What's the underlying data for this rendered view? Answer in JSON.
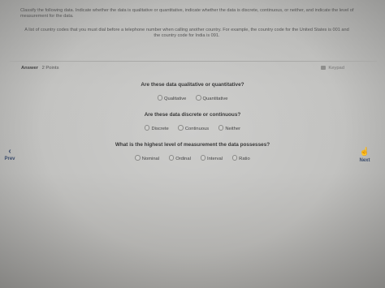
{
  "question": {
    "instructions": "Classify the following data. Indicate whether the data is qualitative or quantitative, indicate whether the data is discrete, continuous, or neither, and indicate the level of measurement for the data.",
    "example": "A list of country codes that you must dial before a telephone number when calling another country. For example, the country code for the United States is 001 and the country code for India is 091."
  },
  "answer": {
    "label": "Answer",
    "points": "2 Points",
    "keypad": "Keypad"
  },
  "parts": [
    {
      "prompt": "Are these data qualitative or quantitative?",
      "options": [
        "Qualitative",
        "Quantitative"
      ]
    },
    {
      "prompt": "Are these data discrete or continuous?",
      "options": [
        "Discrete",
        "Continuous",
        "Neither"
      ]
    },
    {
      "prompt": "What is the highest level of measurement the data possesses?",
      "options": [
        "Nominal",
        "Ordinal",
        "Interval",
        "Ratio"
      ]
    }
  ],
  "nav": {
    "prev": "Prev",
    "next": "Next"
  }
}
